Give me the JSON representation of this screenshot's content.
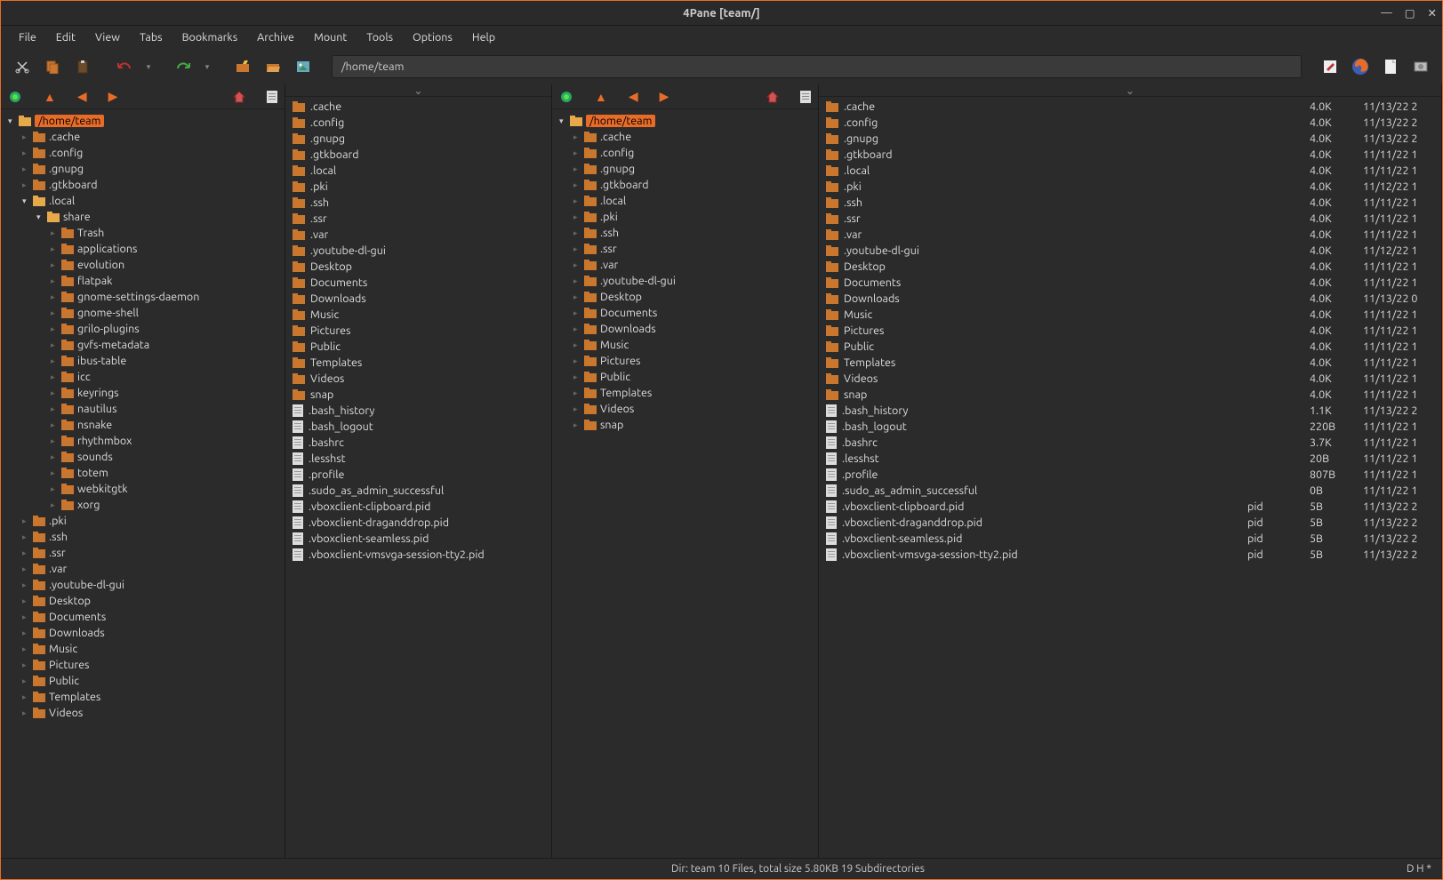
{
  "window": {
    "title": "4Pane [team/]"
  },
  "menu": [
    "File",
    "Edit",
    "View",
    "Tabs",
    "Bookmarks",
    "Archive",
    "Mount",
    "Tools",
    "Options",
    "Help"
  ],
  "path": "/home/team",
  "treeLeft": {
    "root": "/home/team",
    "nodes": [
      {
        "d": 0,
        "label": "/home/team",
        "open": true,
        "sel": true
      },
      {
        "d": 1,
        "label": ".cache"
      },
      {
        "d": 1,
        "label": ".config"
      },
      {
        "d": 1,
        "label": ".gnupg"
      },
      {
        "d": 1,
        "label": ".gtkboard"
      },
      {
        "d": 1,
        "label": ".local",
        "open": true
      },
      {
        "d": 2,
        "label": "share",
        "open": true
      },
      {
        "d": 3,
        "label": "Trash"
      },
      {
        "d": 3,
        "label": "applications"
      },
      {
        "d": 3,
        "label": "evolution"
      },
      {
        "d": 3,
        "label": "flatpak"
      },
      {
        "d": 3,
        "label": "gnome-settings-daemon"
      },
      {
        "d": 3,
        "label": "gnome-shell"
      },
      {
        "d": 3,
        "label": "grilo-plugins"
      },
      {
        "d": 3,
        "label": "gvfs-metadata"
      },
      {
        "d": 3,
        "label": "ibus-table"
      },
      {
        "d": 3,
        "label": "icc"
      },
      {
        "d": 3,
        "label": "keyrings"
      },
      {
        "d": 3,
        "label": "nautilus"
      },
      {
        "d": 3,
        "label": "nsnake"
      },
      {
        "d": 3,
        "label": "rhythmbox"
      },
      {
        "d": 3,
        "label": "sounds"
      },
      {
        "d": 3,
        "label": "totem"
      },
      {
        "d": 3,
        "label": "webkitgtk"
      },
      {
        "d": 3,
        "label": "xorg"
      },
      {
        "d": 1,
        "label": ".pki"
      },
      {
        "d": 1,
        "label": ".ssh"
      },
      {
        "d": 1,
        "label": ".ssr"
      },
      {
        "d": 1,
        "label": ".var"
      },
      {
        "d": 1,
        "label": ".youtube-dl-gui"
      },
      {
        "d": 1,
        "label": "Desktop"
      },
      {
        "d": 1,
        "label": "Documents"
      },
      {
        "d": 1,
        "label": "Downloads"
      },
      {
        "d": 1,
        "label": "Music"
      },
      {
        "d": 1,
        "label": "Pictures"
      },
      {
        "d": 1,
        "label": "Public"
      },
      {
        "d": 1,
        "label": "Templates"
      },
      {
        "d": 1,
        "label": "Videos"
      }
    ]
  },
  "listLeft": [
    {
      "t": "d",
      "n": ".cache"
    },
    {
      "t": "d",
      "n": ".config"
    },
    {
      "t": "d",
      "n": ".gnupg"
    },
    {
      "t": "d",
      "n": ".gtkboard"
    },
    {
      "t": "d",
      "n": ".local"
    },
    {
      "t": "d",
      "n": ".pki"
    },
    {
      "t": "d",
      "n": ".ssh"
    },
    {
      "t": "d",
      "n": ".ssr"
    },
    {
      "t": "d",
      "n": ".var"
    },
    {
      "t": "d",
      "n": ".youtube-dl-gui"
    },
    {
      "t": "d",
      "n": "Desktop"
    },
    {
      "t": "d",
      "n": "Documents"
    },
    {
      "t": "d",
      "n": "Downloads"
    },
    {
      "t": "d",
      "n": "Music"
    },
    {
      "t": "d",
      "n": "Pictures"
    },
    {
      "t": "d",
      "n": "Public"
    },
    {
      "t": "d",
      "n": "Templates"
    },
    {
      "t": "d",
      "n": "Videos"
    },
    {
      "t": "d",
      "n": "snap"
    },
    {
      "t": "f",
      "n": ".bash_history"
    },
    {
      "t": "f",
      "n": ".bash_logout"
    },
    {
      "t": "f",
      "n": ".bashrc"
    },
    {
      "t": "f",
      "n": ".lesshst"
    },
    {
      "t": "f",
      "n": ".profile"
    },
    {
      "t": "f",
      "n": ".sudo_as_admin_successful"
    },
    {
      "t": "f",
      "n": ".vboxclient-clipboard.pid"
    },
    {
      "t": "f",
      "n": ".vboxclient-draganddrop.pid"
    },
    {
      "t": "f",
      "n": ".vboxclient-seamless.pid"
    },
    {
      "t": "f",
      "n": ".vboxclient-vmsvga-session-tty2.pid"
    }
  ],
  "treeRight": {
    "root": "/home/team",
    "nodes": [
      {
        "d": 0,
        "label": "/home/team",
        "open": true,
        "sel": true
      },
      {
        "d": 1,
        "label": ".cache"
      },
      {
        "d": 1,
        "label": ".config"
      },
      {
        "d": 1,
        "label": ".gnupg"
      },
      {
        "d": 1,
        "label": ".gtkboard"
      },
      {
        "d": 1,
        "label": ".local"
      },
      {
        "d": 1,
        "label": ".pki"
      },
      {
        "d": 1,
        "label": ".ssh"
      },
      {
        "d": 1,
        "label": ".ssr"
      },
      {
        "d": 1,
        "label": ".var"
      },
      {
        "d": 1,
        "label": ".youtube-dl-gui"
      },
      {
        "d": 1,
        "label": "Desktop"
      },
      {
        "d": 1,
        "label": "Documents"
      },
      {
        "d": 1,
        "label": "Downloads"
      },
      {
        "d": 1,
        "label": "Music"
      },
      {
        "d": 1,
        "label": "Pictures"
      },
      {
        "d": 1,
        "label": "Public"
      },
      {
        "d": 1,
        "label": "Templates"
      },
      {
        "d": 1,
        "label": "Videos"
      },
      {
        "d": 1,
        "label": "snap"
      }
    ]
  },
  "listRight": [
    {
      "t": "d",
      "n": ".cache",
      "sz": "4.0K",
      "dt": "11/13/22 2"
    },
    {
      "t": "d",
      "n": ".config",
      "sz": "4.0K",
      "dt": "11/13/22 2"
    },
    {
      "t": "d",
      "n": ".gnupg",
      "sz": "4.0K",
      "dt": "11/13/22 2"
    },
    {
      "t": "d",
      "n": ".gtkboard",
      "sz": "4.0K",
      "dt": "11/11/22 1"
    },
    {
      "t": "d",
      "n": ".local",
      "sz": "4.0K",
      "dt": "11/11/22 1"
    },
    {
      "t": "d",
      "n": ".pki",
      "sz": "4.0K",
      "dt": "11/12/22 1"
    },
    {
      "t": "d",
      "n": ".ssh",
      "sz": "4.0K",
      "dt": "11/11/22 1"
    },
    {
      "t": "d",
      "n": ".ssr",
      "sz": "4.0K",
      "dt": "11/11/22 1"
    },
    {
      "t": "d",
      "n": ".var",
      "sz": "4.0K",
      "dt": "11/11/22 1"
    },
    {
      "t": "d",
      "n": ".youtube-dl-gui",
      "sz": "4.0K",
      "dt": "11/12/22 1"
    },
    {
      "t": "d",
      "n": "Desktop",
      "sz": "4.0K",
      "dt": "11/11/22 1"
    },
    {
      "t": "d",
      "n": "Documents",
      "sz": "4.0K",
      "dt": "11/11/22 1"
    },
    {
      "t": "d",
      "n": "Downloads",
      "sz": "4.0K",
      "dt": "11/13/22 0"
    },
    {
      "t": "d",
      "n": "Music",
      "sz": "4.0K",
      "dt": "11/11/22 1"
    },
    {
      "t": "d",
      "n": "Pictures",
      "sz": "4.0K",
      "dt": "11/11/22 1"
    },
    {
      "t": "d",
      "n": "Public",
      "sz": "4.0K",
      "dt": "11/11/22 1"
    },
    {
      "t": "d",
      "n": "Templates",
      "sz": "4.0K",
      "dt": "11/11/22 1"
    },
    {
      "t": "d",
      "n": "Videos",
      "sz": "4.0K",
      "dt": "11/11/22 1"
    },
    {
      "t": "d",
      "n": "snap",
      "sz": "4.0K",
      "dt": "11/11/22 1"
    },
    {
      "t": "f",
      "n": ".bash_history",
      "sz": "1.1K",
      "dt": "11/13/22 2"
    },
    {
      "t": "f",
      "n": ".bash_logout",
      "sz": "220B",
      "dt": "11/11/22 1"
    },
    {
      "t": "f",
      "n": ".bashrc",
      "sz": "3.7K",
      "dt": "11/11/22 1"
    },
    {
      "t": "f",
      "n": ".lesshst",
      "sz": "20B",
      "dt": "11/11/22 1"
    },
    {
      "t": "f",
      "n": ".profile",
      "sz": "807B",
      "dt": "11/11/22 1"
    },
    {
      "t": "f",
      "n": ".sudo_as_admin_successful",
      "sz": "0B",
      "dt": "11/11/22 1"
    },
    {
      "t": "f",
      "n": ".vboxclient-clipboard.pid",
      "ext": "pid",
      "sz": "5B",
      "dt": "11/13/22 2"
    },
    {
      "t": "f",
      "n": ".vboxclient-draganddrop.pid",
      "ext": "pid",
      "sz": "5B",
      "dt": "11/13/22 2"
    },
    {
      "t": "f",
      "n": ".vboxclient-seamless.pid",
      "ext": "pid",
      "sz": "5B",
      "dt": "11/13/22 2"
    },
    {
      "t": "f",
      "n": ".vboxclient-vmsvga-session-tty2.pid",
      "ext": "pid",
      "sz": "5B",
      "dt": "11/13/22 2"
    }
  ],
  "status": {
    "center": "Dir: team   10 Files, total size 5.80KB   19 Subdirectories",
    "right": "D H   *"
  }
}
